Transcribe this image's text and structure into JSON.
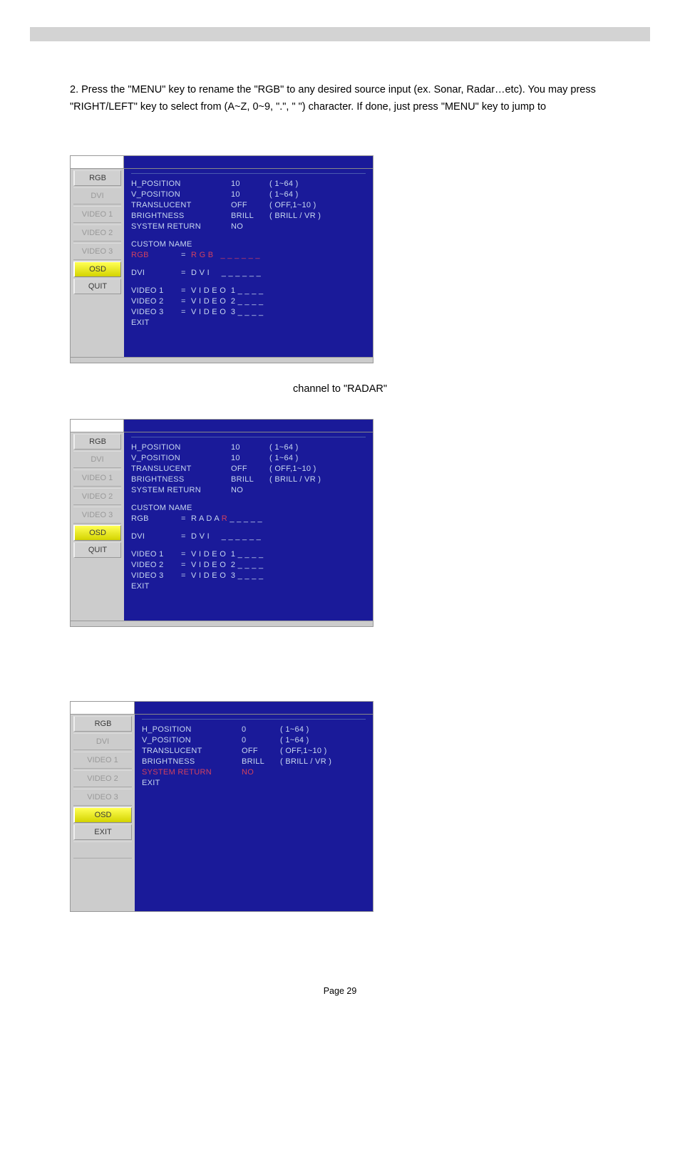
{
  "instruction": "2. Press the \"MENU\" key to rename the \"RGB\" to any desired source input (ex. Sonar, Radar…etc). You may press \"RIGHT/LEFT\" key to select from (A~Z, 0~9, \".\", \" \") character. If done, just press \"MENU\" key to jump to",
  "caption1": "channel to \"RADAR\"",
  "page_num": "Page 29",
  "screen1": {
    "sidebar": {
      "rgb": "RGB",
      "dvi": "DVI",
      "v1": "VIDEO 1",
      "v2": "VIDEO 2",
      "v3": "VIDEO 3",
      "osd": "OSD",
      "quit": "QUIT"
    },
    "rows": {
      "hpos": {
        "l": "H_POSITION",
        "v": "10",
        "r": "( 1~64 )"
      },
      "vpos": {
        "l": "V_POSITION",
        "v": "10",
        "r": "( 1~64 )"
      },
      "trans": {
        "l": "TRANSLUCENT",
        "v": "OFF",
        "r": "( OFF,1~10 )"
      },
      "bright": {
        "l": "BRIGHTNESS",
        "v": "BRILL",
        "r": "( BRILL / VR )"
      },
      "sysret": {
        "l": "SYSTEM RETURN",
        "v": "NO",
        "r": ""
      }
    },
    "custom_name": "CUSTOM NAME",
    "names": {
      "rgb": {
        "k": "RGB",
        "eq": "=",
        "v": "R G B   _ _ _ _ _ _"
      },
      "dvi": {
        "k": "DVI",
        "eq": "=",
        "v": "D V I     _ _ _ _ _ _"
      },
      "v1": {
        "k": "VIDEO 1",
        "eq": "=",
        "v": "V I D E O  1 _ _ _ _"
      },
      "v2": {
        "k": "VIDEO 2",
        "eq": "=",
        "v": "V I D E O  2 _ _ _ _"
      },
      "v3": {
        "k": "VIDEO 3",
        "eq": "=",
        "v": "V I D E O  3 _ _ _ _"
      }
    },
    "exit": "EXIT"
  },
  "screen2": {
    "sidebar": {
      "rgb": "RGB",
      "dvi": "DVI",
      "v1": "VIDEO 1",
      "v2": "VIDEO 2",
      "v3": "VIDEO 3",
      "osd": "OSD",
      "quit": "QUIT"
    },
    "rows": {
      "hpos": {
        "l": "H_POSITION",
        "v": "10",
        "r": "( 1~64 )"
      },
      "vpos": {
        "l": "V_POSITION",
        "v": "10",
        "r": "( 1~64 )"
      },
      "trans": {
        "l": "TRANSLUCENT",
        "v": "OFF",
        "r": "( OFF,1~10 )"
      },
      "bright": {
        "l": "BRIGHTNESS",
        "v": "BRILL",
        "r": "( BRILL / VR )"
      },
      "sysret": {
        "l": "SYSTEM RETURN",
        "v": "NO",
        "r": ""
      }
    },
    "custom_name": "CUSTOM NAME",
    "names": {
      "rgb": {
        "k": "RGB",
        "eq": "=",
        "v_a": "R A D A ",
        "v_b": "R",
        "v_c": " _ _ _ _ _"
      },
      "dvi": {
        "k": "DVI",
        "eq": "=",
        "v": "D V I     _ _ _ _ _ _"
      },
      "v1": {
        "k": "VIDEO 1",
        "eq": "=",
        "v": "V I D E O  1 _ _ _ _"
      },
      "v2": {
        "k": "VIDEO 2",
        "eq": "=",
        "v": "V I D E O  2 _ _ _ _"
      },
      "v3": {
        "k": "VIDEO 3",
        "eq": "=",
        "v": "V I D E O  3 _ _ _ _"
      }
    },
    "exit": "EXIT"
  },
  "screen3": {
    "sidebar": {
      "rgb": "RGB",
      "dvi": "DVI",
      "v1": "VIDEO 1",
      "v2": "VIDEO 2",
      "v3": "VIDEO 3",
      "osd": "OSD",
      "exit": "EXIT"
    },
    "rows": {
      "hpos": {
        "l": "H_POSITION",
        "v": "0",
        "r": "( 1~64 )"
      },
      "vpos": {
        "l": "V_POSITION",
        "v": "0",
        "r": "( 1~64 )"
      },
      "trans": {
        "l": "TRANSLUCENT",
        "v": "OFF",
        "r": "( OFF,1~10 )"
      },
      "bright": {
        "l": "BRIGHTNESS",
        "v": "BRILL",
        "r": "( BRILL / VR )"
      },
      "sysret": {
        "l": "SYSTEM RETURN",
        "v": "NO",
        "r": ""
      }
    },
    "exit": "EXIT"
  }
}
